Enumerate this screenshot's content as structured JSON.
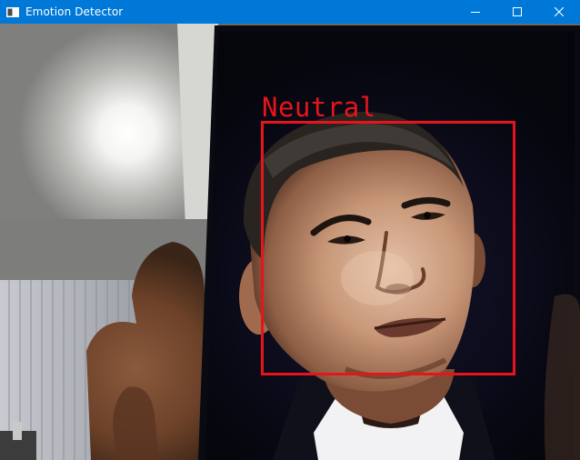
{
  "window": {
    "title": "Emotion Detector",
    "icon": "app-window-icon",
    "controls": [
      "minimize-icon",
      "maximize-icon",
      "close-icon"
    ]
  },
  "detection": {
    "emotion": "Neutral",
    "box_color": "#e8141b"
  },
  "colors": {
    "titlebar": "#0078d7",
    "label": "#e8141b"
  }
}
